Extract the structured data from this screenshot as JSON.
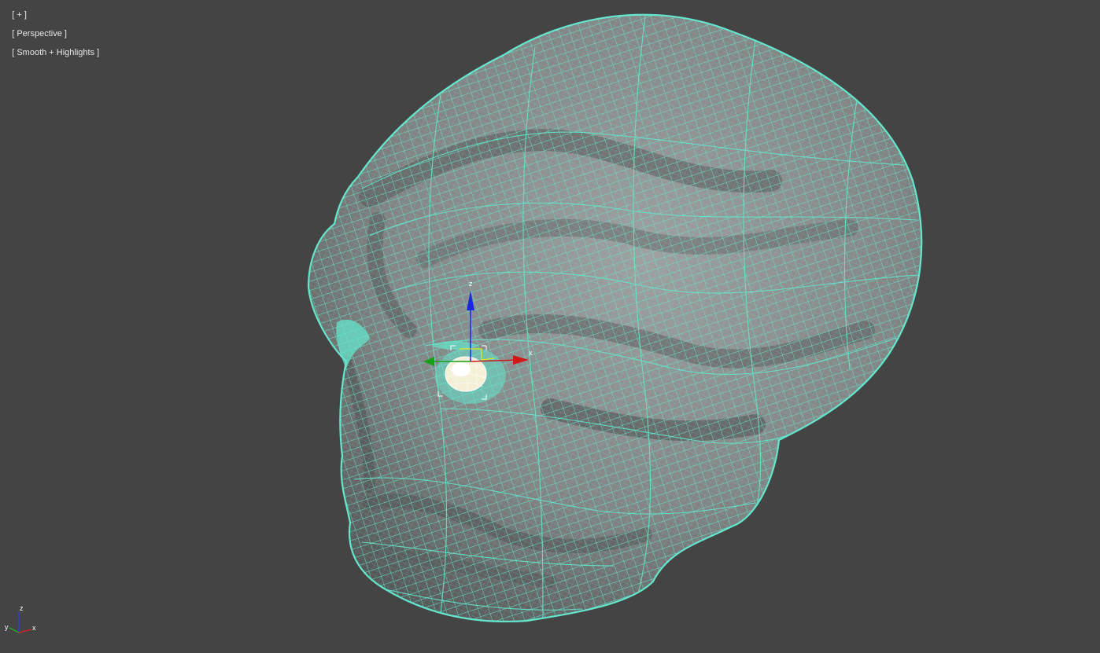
{
  "viewport": {
    "menu_label": "[ + ]",
    "view_label": "[ Perspective ]",
    "shading_label": "[ Smooth + Highlights ]",
    "background_color": "#444444"
  },
  "model": {
    "wire_color": "#64e6cc",
    "surface_color": "#8a8a8a"
  },
  "gizmo": {
    "x_label": "x",
    "z_label": "z",
    "x_color": "#d01818",
    "y_color": "#18a018",
    "z_color": "#1c28e0"
  },
  "axis_tripod": {
    "x_label": "x",
    "y_label": "y",
    "z_label": "z"
  }
}
